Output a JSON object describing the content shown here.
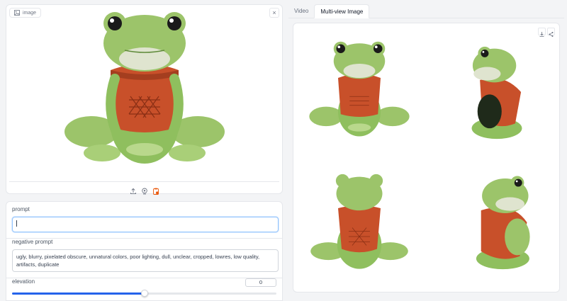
{
  "input_image": {
    "label": "image",
    "clear_icon": "close-icon"
  },
  "source_icons": [
    "upload-icon",
    "webcam-icon",
    "clipboard-icon"
  ],
  "prompt": {
    "label": "prompt",
    "value": ""
  },
  "negative_prompt": {
    "label": "negative prompt",
    "value": "ugly, blurry, pixelated obscure, unnatural colors, poor lighting, dull, unclear, cropped, lowres, low quality, artifacts, duplicate"
  },
  "elevation": {
    "label": "elevation",
    "value": "0",
    "slider_fraction": 0.5
  },
  "tabs": [
    {
      "label": "Video",
      "active": false
    },
    {
      "label": "Multi-view Image",
      "active": true
    }
  ],
  "gallery_tools": [
    "download-icon",
    "share-icon"
  ],
  "colors": {
    "accent": "#2563eb",
    "frog_green": "#8fbf5e",
    "sweater": "#c8502a"
  }
}
